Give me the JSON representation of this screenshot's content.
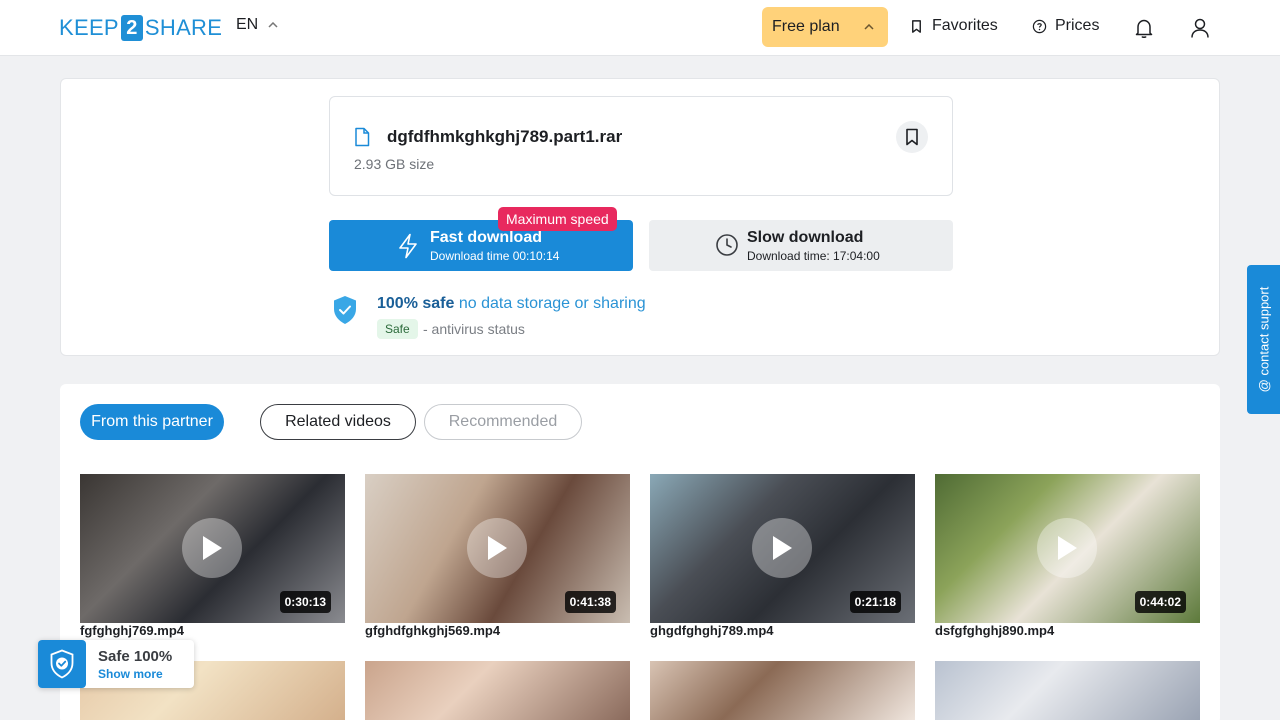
{
  "header": {
    "logo_left": "KEEP",
    "logo_mid": "2",
    "logo_right": "SHARE",
    "language": "EN",
    "plan_label": "Free plan",
    "favorites_label": "Favorites",
    "prices_label": "Prices"
  },
  "file": {
    "name": "dgfdfhmkghkghj789.part1.rar",
    "size": "2.93 GB size"
  },
  "download": {
    "fast_title": "Fast download",
    "fast_sub": "Download time 00:10:14",
    "badge": "Maximum speed",
    "slow_title": "Slow download",
    "slow_sub": "Download time: 17:04:00"
  },
  "safety": {
    "strong": "100% safe",
    "light": " no data storage or sharing",
    "badge": "Safe",
    "status": "- antivirus status"
  },
  "tabs": [
    {
      "label": "From this partner"
    },
    {
      "label": "Related videos"
    },
    {
      "label": "Recommended"
    }
  ],
  "videos": [
    {
      "name": "fgfghghj769.mp4",
      "duration": "0:30:13"
    },
    {
      "name": "gfghdfghkghj569.mp4",
      "duration": "0:41:38"
    },
    {
      "name": "ghgdfghghj789.mp4",
      "duration": "0:21:18"
    },
    {
      "name": "dsfgfghghj890.mp4",
      "duration": "0:44:02"
    }
  ],
  "contact_support": "@ contact support",
  "safe_widget": {
    "title": "Safe 100%",
    "more": "Show more"
  },
  "colors": {
    "brand": "#1a8ad8",
    "plan": "#ffd27a",
    "badge": "#e8295e"
  }
}
